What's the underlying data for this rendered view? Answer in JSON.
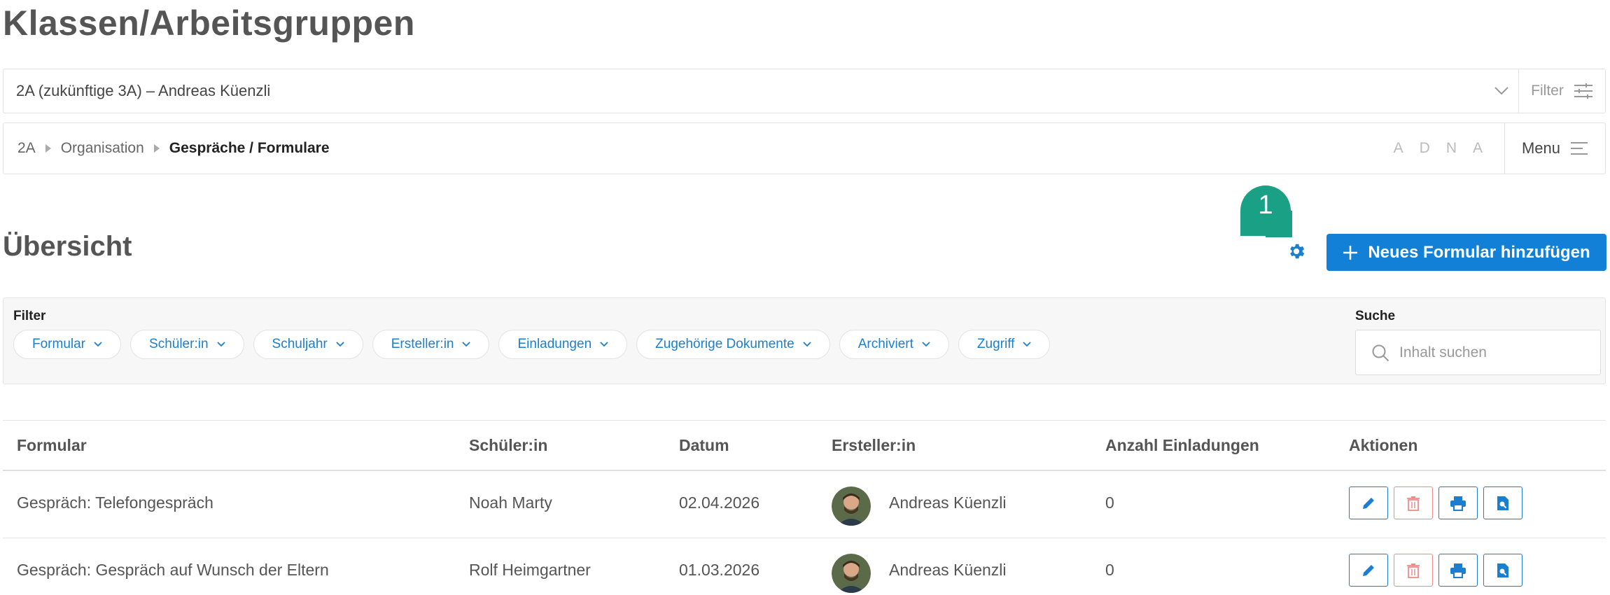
{
  "page": {
    "title": "Klassen/Arbeitsgruppen"
  },
  "class_select": {
    "value": "2A (zukünftige 3A) – Andreas Küenzli",
    "filter_label": "Filter"
  },
  "breadcrumb": {
    "items": [
      "2A",
      "Organisation",
      "Gespräche / Formulare"
    ],
    "letters": [
      "A",
      "D",
      "N",
      "A"
    ],
    "menu_label": "Menu"
  },
  "overview": {
    "title": "Übersicht",
    "badge_number": "1",
    "add_button_label": "Neues Formular hinzufügen"
  },
  "filters": {
    "label": "Filter",
    "chips": [
      "Formular",
      "Schüler:in",
      "Schuljahr",
      "Ersteller:in",
      "Einladungen",
      "Zugehörige Dokumente",
      "Archiviert",
      "Zugriff"
    ],
    "search_label": "Suche",
    "search_placeholder": "Inhalt suchen"
  },
  "table": {
    "headers": [
      "Formular",
      "Schüler:in",
      "Datum",
      "Ersteller:in",
      "Anzahl Einladungen",
      "Aktionen"
    ],
    "rows": [
      {
        "formular": "Gespräch: Telefongespräch",
        "schueler": "Noah Marty",
        "datum": "02.04.2026",
        "ersteller": "Andreas Küenzli",
        "einladungen": "0"
      },
      {
        "formular": "Gespräch: Gespräch auf Wunsch der Eltern",
        "schueler": "Rolf Heimgartner",
        "datum": "01.03.2026",
        "ersteller": "Andreas Küenzli",
        "einladungen": "0"
      }
    ]
  },
  "colors": {
    "accent": "#1380d8",
    "badge": "#1aa085",
    "danger": "#f08a8a"
  }
}
